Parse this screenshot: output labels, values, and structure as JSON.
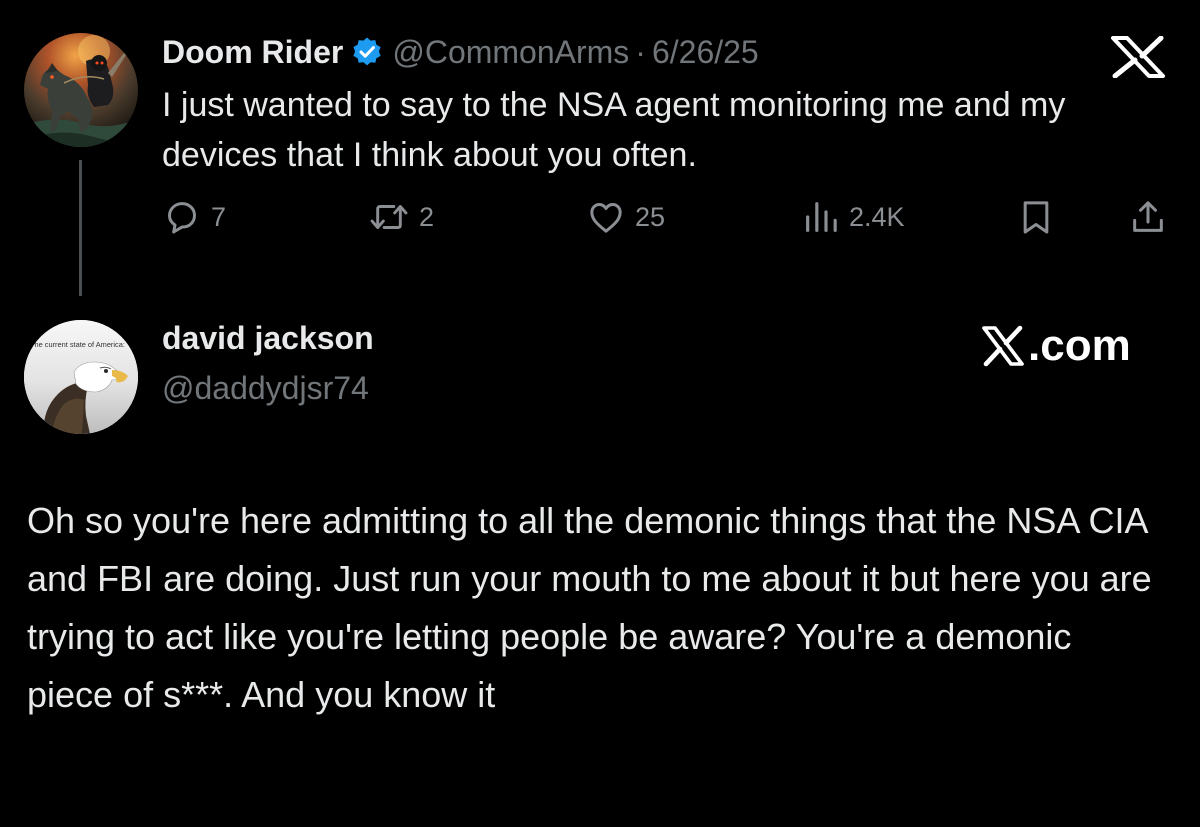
{
  "original_tweet": {
    "display_name": "Doom Rider",
    "handle": "@CommonArms",
    "separator": "·",
    "date": "6/26/25",
    "text": "I just wanted to say to the NSA agent monitoring me and my devices that I think about you often.",
    "metrics": {
      "replies": "7",
      "reposts": "2",
      "likes": "25",
      "views": "2.4K"
    },
    "icons": {
      "badge": "verified-icon",
      "logo": "x-logo-icon",
      "reply": "reply-icon",
      "repost": "repost-icon",
      "like": "heart-icon",
      "views": "views-icon",
      "bookmark": "bookmark-icon",
      "share": "share-icon"
    }
  },
  "reply": {
    "display_name": "david jackson",
    "handle": "@daddydjsr74",
    "avatar_caption": "The current state of America:",
    "brand": "X.com",
    "text": "Oh so you're here admitting to all the demonic things that the NSA CIA and FBI are doing. Just run your mouth to me about it but here you are trying to act like you're letting people be aware? You're a demonic piece of s***. And you know it"
  },
  "colors": {
    "background": "#000000",
    "text": "#e7e9ea",
    "secondary": "#71767b",
    "verified": "#1d9bf0",
    "thread_line": "#4b4f54"
  }
}
